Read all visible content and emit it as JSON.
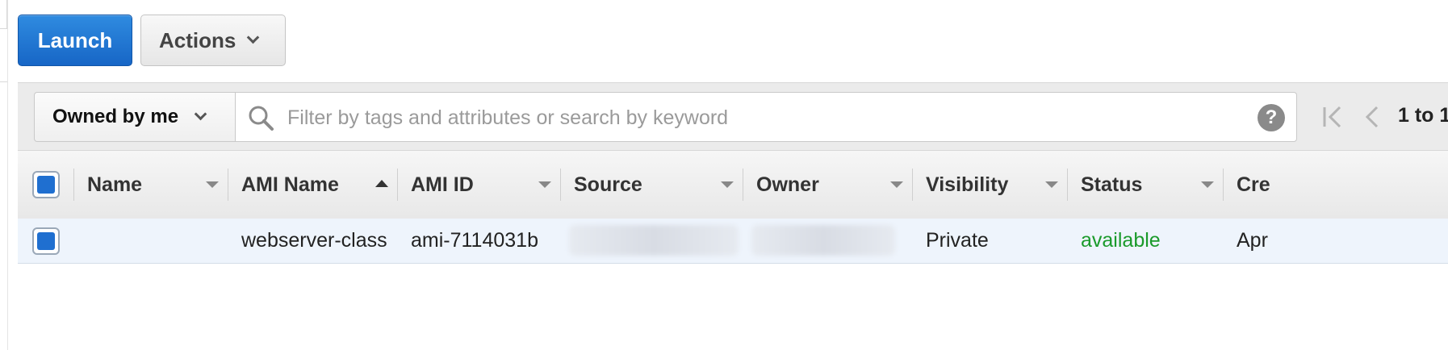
{
  "buttons": {
    "launch": "Launch",
    "actions": "Actions"
  },
  "filter": {
    "owner_selected": "Owned by me",
    "search_placeholder": "Filter by tags and attributes or search by keyword",
    "help_symbol": "?"
  },
  "pager": {
    "range_text": "1 to 1"
  },
  "table": {
    "columns": [
      "Name",
      "AMI Name",
      "AMI ID",
      "Source",
      "Owner",
      "Visibility",
      "Status",
      "Cre"
    ],
    "sorted_column": "AMI Name",
    "sort_direction": "ascending",
    "rows": [
      {
        "selected": true,
        "name": "",
        "ami_name": "webserver-class",
        "ami_id": "ami-7114031b",
        "source": "(redacted)",
        "owner": "(redacted)",
        "visibility": "Private",
        "status": "available",
        "creation_date": "Apr"
      }
    ]
  },
  "colors": {
    "primary_button": "#1766c6",
    "status_available": "#1a9a2b",
    "selected_row": "#eef4fc",
    "checkbox_fill": "#1f6fd0"
  }
}
